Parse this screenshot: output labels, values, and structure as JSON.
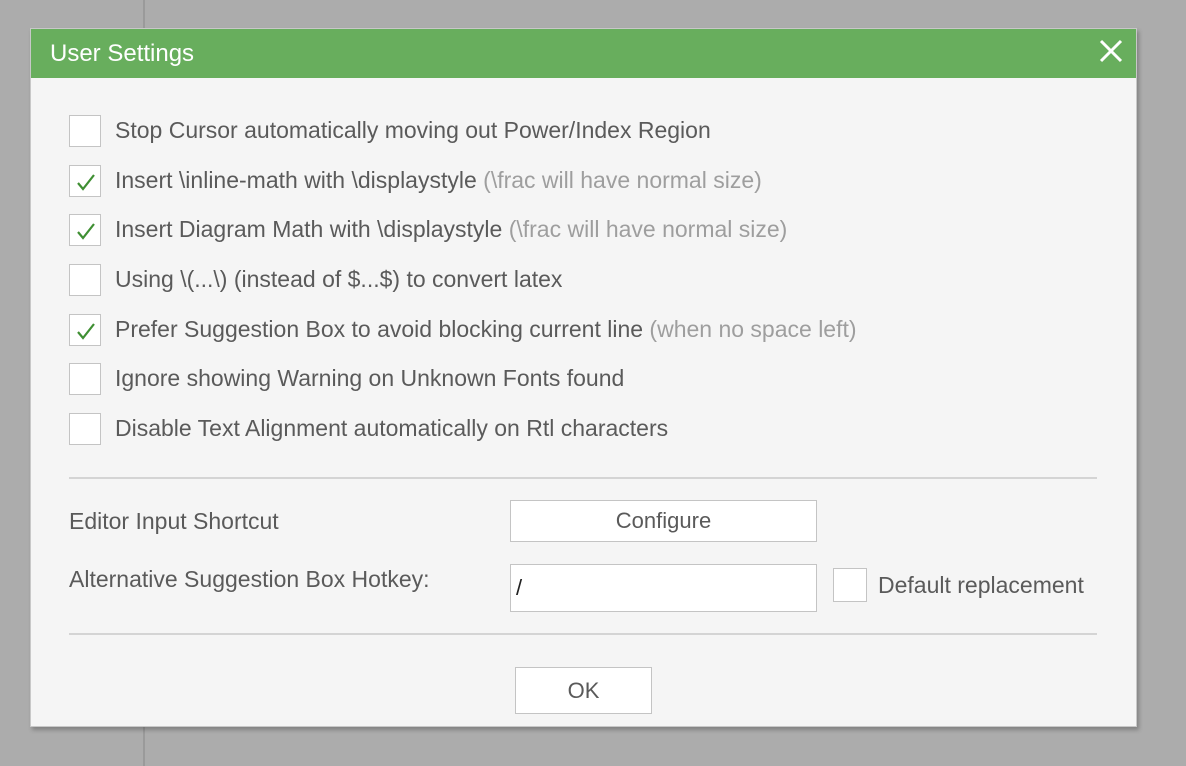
{
  "dialog": {
    "title": "User Settings",
    "close_icon": "close-icon"
  },
  "options": [
    {
      "label": "Stop Cursor automatically moving out Power/Index Region",
      "hint": "",
      "checked": false
    },
    {
      "label": "Insert \\inline-math with \\displaystyle",
      "hint": "(\\frac will have normal size)",
      "checked": true
    },
    {
      "label": "Insert Diagram Math with \\displaystyle",
      "hint": "(\\frac will have normal size)",
      "checked": true
    },
    {
      "label": "Using \\(...\\) (instead of $...$) to convert latex",
      "hint": "",
      "checked": false
    },
    {
      "label": "Prefer Suggestion Box to avoid blocking current line",
      "hint": "(when no space left)",
      "checked": true
    },
    {
      "label": "Ignore showing Warning on Unknown Fonts found",
      "hint": "",
      "checked": false
    },
    {
      "label": "Disable Text Alignment automatically on Rtl characters",
      "hint": "",
      "checked": false
    }
  ],
  "shortcut": {
    "label": "Editor Input Shortcut",
    "button_label": "Configure"
  },
  "hotkey": {
    "label": "Alternative Suggestion Box Hotkey:",
    "value": "/",
    "default_label": "Default replacement",
    "default_checked": false
  },
  "footer": {
    "ok_label": "OK"
  },
  "colors": {
    "accent": "#68ae5d",
    "check": "#3f8f33",
    "text": "#5a5a5a",
    "hint": "#9e9e9e"
  }
}
